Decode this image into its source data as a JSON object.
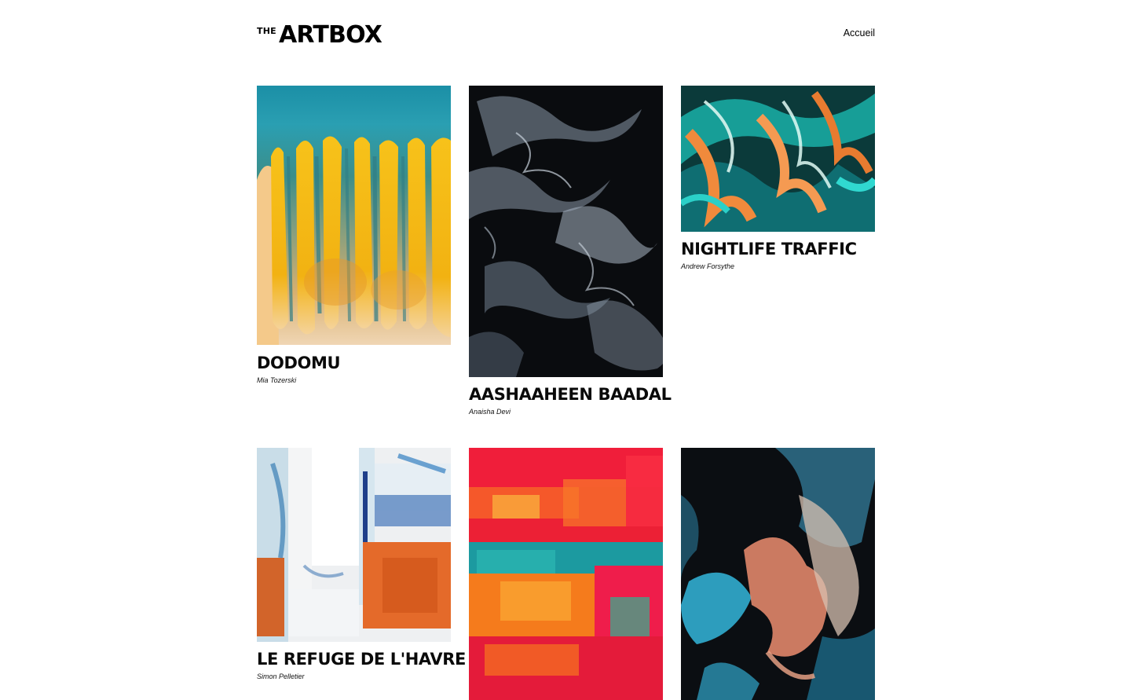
{
  "site": {
    "logo_small": "THE",
    "logo_main": "ARTBOX"
  },
  "nav": {
    "home_label": "Accueil"
  },
  "artworks": [
    {
      "title": "DODOMU",
      "artist": "Mia Tozerski"
    },
    {
      "title": "AASHAAHEEN BAADAL",
      "artist": "Anaisha Devi"
    },
    {
      "title": "NIGHTLIFE TRAFFIC",
      "artist": "Andrew Forsythe"
    },
    {
      "title": "LE REFUGE DE L'HAVRE",
      "artist": "Simon Pelletier"
    },
    {
      "title": "",
      "artist": ""
    },
    {
      "title": "",
      "artist": ""
    }
  ]
}
